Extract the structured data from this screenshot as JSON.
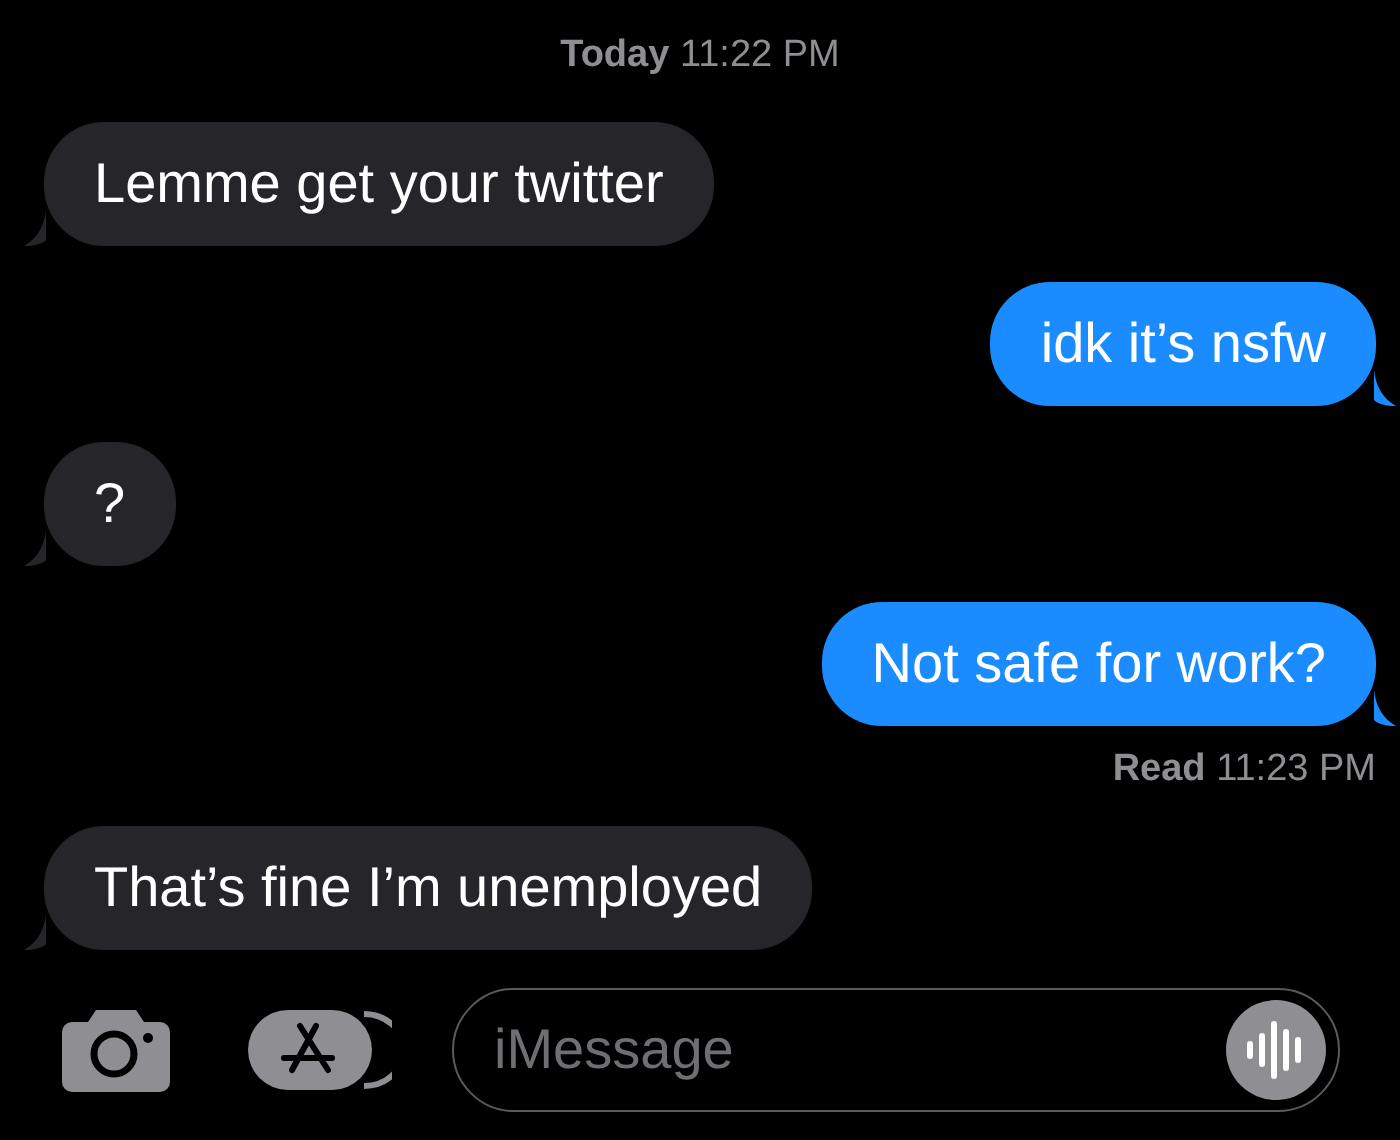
{
  "messages": [
    {
      "kind": "timestamp",
      "text": "**Today** 11:22 PM"
    },
    {
      "kind": "incoming",
      "text": "Lemme get your twitter"
    },
    {
      "kind": "outgoing",
      "text": "idk it’s nsfw"
    },
    {
      "kind": "incoming",
      "text": "?"
    },
    {
      "kind": "outgoing",
      "text": "Not safe for work?"
    },
    {
      "kind": "receipt",
      "text": "**Read** 11:23 PM"
    },
    {
      "kind": "incoming",
      "text": "That’s fine I’m unemployed"
    }
  ],
  "composer": {
    "placeholder": "iMessage"
  }
}
